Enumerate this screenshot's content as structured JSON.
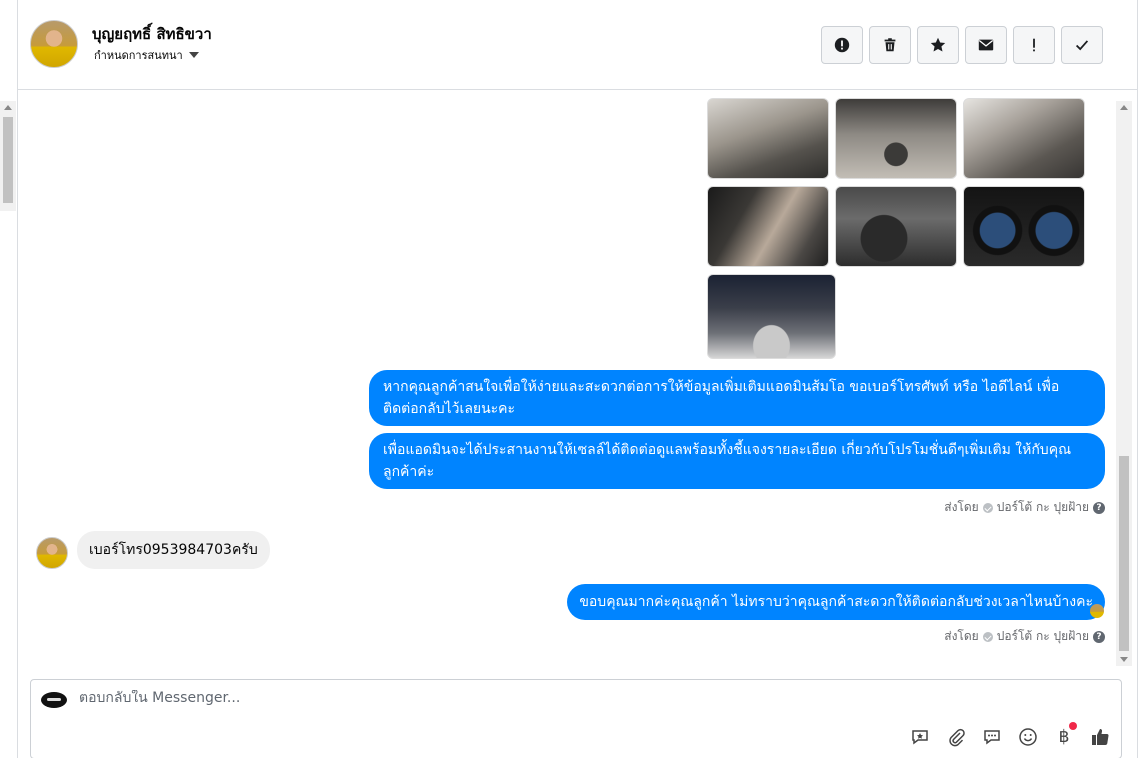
{
  "header": {
    "contact_name": "บุญยฤทธิ์ สิทธิขวา",
    "subtitle": "กำหนดการสนทนา",
    "actions": [
      {
        "name": "report-button",
        "icon": "alert-circle-icon"
      },
      {
        "name": "delete-button",
        "icon": "trash-icon"
      },
      {
        "name": "star-button",
        "icon": "star-icon"
      },
      {
        "name": "mark-unread-button",
        "icon": "envelope-icon"
      },
      {
        "name": "important-button",
        "icon": "exclamation-icon"
      },
      {
        "name": "done-button",
        "icon": "check-icon"
      }
    ]
  },
  "thread": {
    "messages": [
      {
        "from": "page",
        "text": "หากคุณลูกค้าสนใจเพื่อให้ง่ายและสะดวกต่อการให้ข้อมูลเพิ่มเติมแอดมินส้มโอ ขอเบอร์โทรศัพท์ หรือ ไอดีไลน์ เพื่อติดต่อกลับไว้เลยนะคะ"
      },
      {
        "from": "page",
        "text": "เพื่อแอดมินจะได้ประสานงานให้เซลล์ได้ติดต่อดูแลพร้อมทั้งชี้แจงรายละเอียด เกี่ยวกับโปรโมชั่นดีๆเพิ่มเติม ให้กับคุณลูกค้าค่ะ"
      },
      {
        "from": "customer",
        "text": "เบอร์โทร0953984703ครับ"
      },
      {
        "from": "page",
        "text": "ขอบคุณมากค่ะคุณลูกค้า ไม่ทราบว่าคุณลูกค้าสะดวกให้ติดต่อกลับช่วงเวลาไหนบ้างคะ"
      }
    ],
    "sent_by_label": "ส่งโดย",
    "sent_by_name": "ปอร์โต้ กะ ปุยฝ้าย",
    "help_mark": "?"
  },
  "composer": {
    "placeholder": "ตอบกลับใน Messenger...",
    "value": "",
    "currency_symbol": "฿",
    "tools": [
      "saved-reply-icon",
      "attachment-icon",
      "chat-bubble-icon",
      "emoji-icon",
      "baht-payment-icon",
      "thumbs-up-icon"
    ]
  },
  "colors": {
    "accent": "#0084ff",
    "incoming_bubble": "#f0f0f0",
    "muted_text": "#65676b",
    "badge": "#f02849"
  }
}
